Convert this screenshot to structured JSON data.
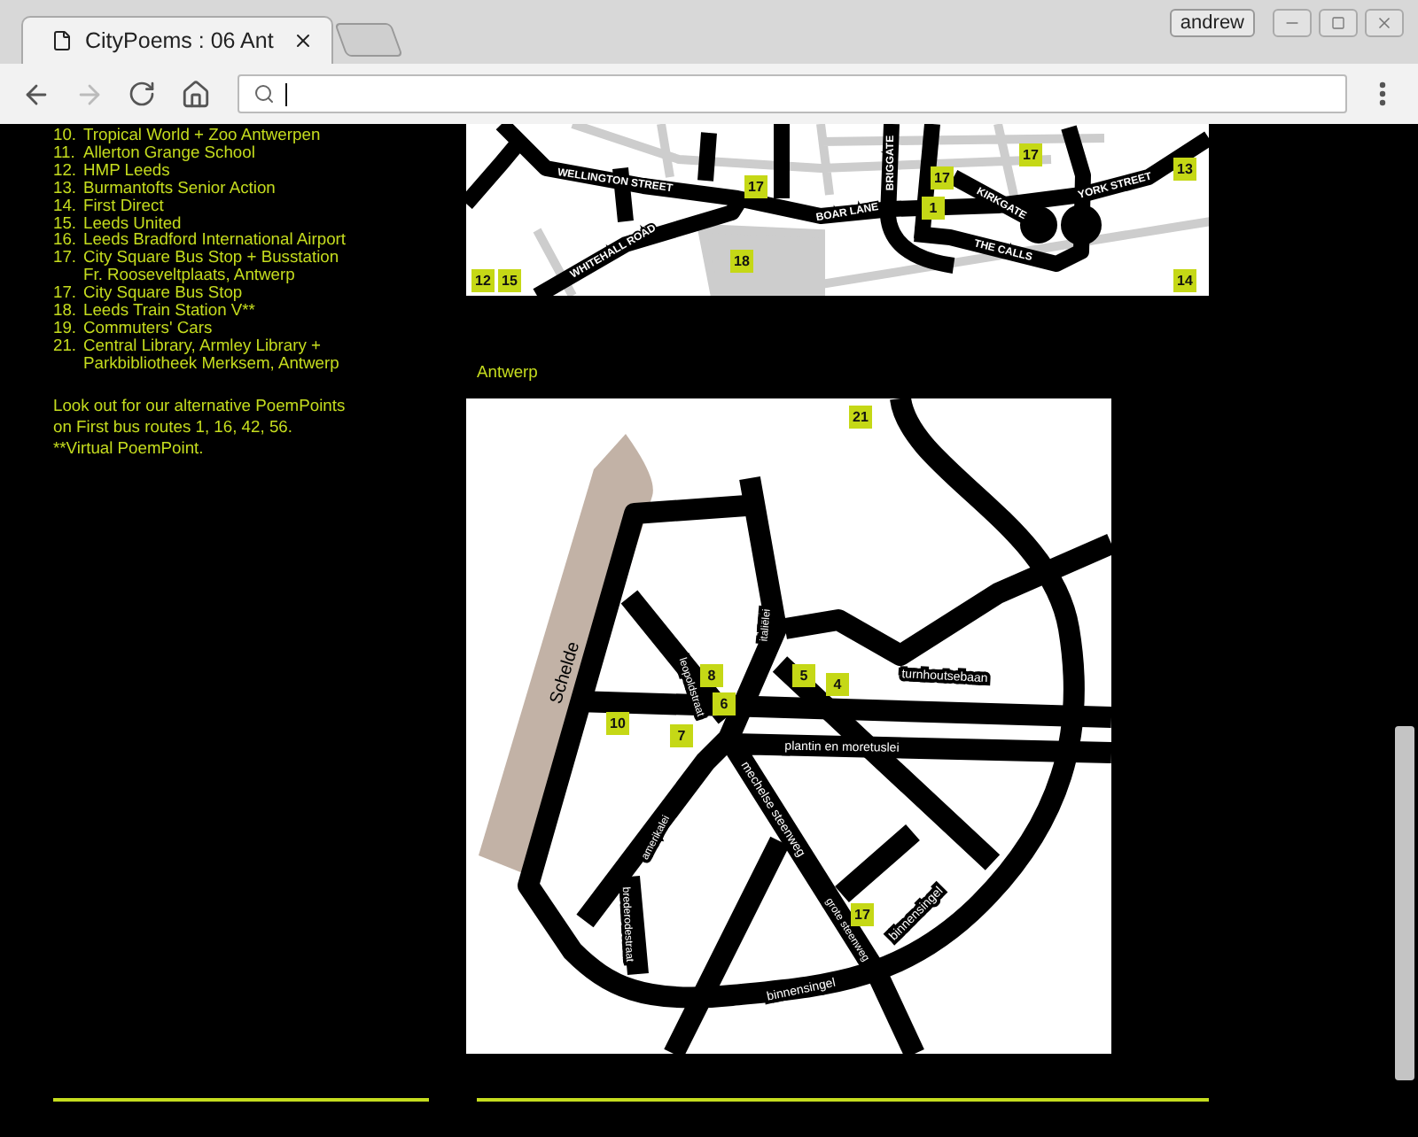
{
  "browser": {
    "tab_title": "CityPoems : 06 Ant",
    "user": "andrew",
    "back_disabled": false,
    "forward_disabled": true
  },
  "list": [
    {
      "number": "10.",
      "lines": [
        "Tropical World + Zoo Antwerpen"
      ]
    },
    {
      "number": "11.",
      "lines": [
        "Allerton Grange School"
      ]
    },
    {
      "number": "12.",
      "lines": [
        "HMP Leeds"
      ]
    },
    {
      "number": "13.",
      "lines": [
        "Burmantofts Senior Action"
      ]
    },
    {
      "number": "14.",
      "lines": [
        "First Direct"
      ]
    },
    {
      "number": "15.",
      "lines": [
        "Leeds United"
      ]
    },
    {
      "number": "16.",
      "lines": [
        "Leeds Bradford International Airport"
      ]
    },
    {
      "number": "17.",
      "lines": [
        "City Square Bus Stop + Busstation",
        "Fr. Rooseveltplaats, Antwerp"
      ]
    },
    {
      "number": "17.",
      "lines": [
        "City Square Bus Stop"
      ]
    },
    {
      "number": "18.",
      "lines": [
        "Leeds Train Station V**"
      ]
    },
    {
      "number": "19.",
      "lines": [
        "Commuters' Cars"
      ]
    },
    {
      "number": "21.",
      "lines": [
        "Central Library, Armley Library +",
        "Parkbibliotheek Merksem, Antwerp"
      ]
    }
  ],
  "note": [
    "Look out for our alternative PoemPoints",
    "on First bus routes 1, 16, 42, 56.",
    "**Virtual PoemPoint."
  ],
  "leeds_map": {
    "streets": [
      "WELLINGTON STREET",
      "WHITEHALL ROAD",
      "BOAR LANE",
      "KIRKGATE",
      "THE CALLS",
      "YORK STREET",
      "BRIGGATE"
    ],
    "markers": [
      "17",
      "13",
      "17",
      "17",
      "1",
      "18",
      "12",
      "15",
      "14"
    ]
  },
  "antwerp_map": {
    "heading": "Antwerp",
    "streets": [
      "Schelde",
      "italiëlei",
      "turnhoutsebaan",
      "leopoldstraat",
      "plantin en moretuslei",
      "mechelse steenweg",
      "amerikalei",
      "brederodestraat",
      "grote steenweg",
      "binnensingel",
      "binnensingel"
    ],
    "markers": [
      "21",
      "8",
      "6",
      "5",
      "4",
      "10",
      "7",
      "17"
    ]
  }
}
